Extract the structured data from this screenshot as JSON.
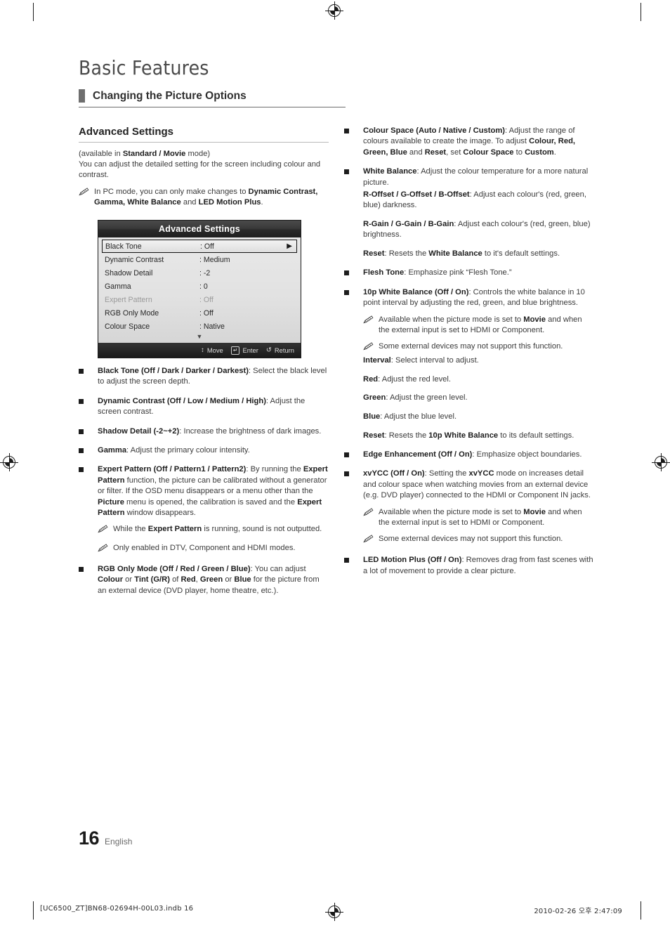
{
  "document": {
    "title": "Basic Features",
    "section_title": "Changing the Picture Options",
    "page_number": "16",
    "language": "English"
  },
  "left_column": {
    "sub_heading": "Advanced Settings",
    "intro_line1_pre": "(available in ",
    "intro_line1_bold": "Standard / Movie",
    "intro_line1_post": " mode)",
    "intro_line2": "You can adjust the detailed setting for the screen including colour and contrast.",
    "note_pc_pre": "In PC mode, you can only make changes to ",
    "note_pc_bold1": "Dynamic Contrast, Gamma, White Balance",
    "note_pc_mid": " and ",
    "note_pc_bold2": "LED Motion Plus",
    "note_pc_post": ".",
    "bullets": {
      "black_tone_bold": "Black Tone (Off / Dark / Darker / Darkest)",
      "black_tone_text": ": Select the black level to adjust the screen depth.",
      "dynamic_contrast_bold": "Dynamic Contrast (Off / Low / Medium / High)",
      "dynamic_contrast_text": ": Adjust the screen contrast.",
      "shadow_detail_bold": "Shadow Detail (-2~+2)",
      "shadow_detail_text": ": Increase the brightness of dark images.",
      "gamma_bold": "Gamma",
      "gamma_text": ": Adjust the primary colour intensity.",
      "expert_pattern_bold": "Expert Pattern (Off / Pattern1 / Pattern2)",
      "expert_pattern_t1": ": By running the ",
      "expert_pattern_b2": "Expert Pattern",
      "expert_pattern_t2": " function, the picture can be calibrated without a generator or filter. If the OSD menu disappears or a menu other than the ",
      "expert_pattern_b3": "Picture",
      "expert_pattern_t3": " menu is opened, the calibration is saved and the ",
      "expert_pattern_b4": "Expert Pattern",
      "expert_pattern_t4": " window disappears.",
      "note_sound_pre": "While the ",
      "note_sound_bold": "Expert Pattern",
      "note_sound_post": " is running, sound is not outputted.",
      "note_dtv": "Only enabled in DTV, Component and HDMI modes.",
      "rgb_only_bold": "RGB Only Mode (Off / Red / Green / Blue)",
      "rgb_only_t1": ": You can adjust ",
      "rgb_only_b2": "Colour",
      "rgb_only_t2": " or ",
      "rgb_only_b3": "Tint (G/R)",
      "rgb_only_t3": " of ",
      "rgb_only_b4": "Red",
      "rgb_only_t4": ", ",
      "rgb_only_b5": "Green",
      "rgb_only_t5": " or ",
      "rgb_only_b6": "Blue",
      "rgb_only_t6": " for the picture from an external device (DVD player, home theatre, etc.)."
    }
  },
  "osd": {
    "title": "Advanced Settings",
    "rows": [
      {
        "label": "Black Tone",
        "value": ": Off",
        "selected": true,
        "dim": false,
        "arrow": "▶"
      },
      {
        "label": "Dynamic Contrast",
        "value": ": Medium",
        "selected": false,
        "dim": false,
        "arrow": ""
      },
      {
        "label": "Shadow Detail",
        "value": ": -2",
        "selected": false,
        "dim": false,
        "arrow": ""
      },
      {
        "label": "Gamma",
        "value": ": 0",
        "selected": false,
        "dim": false,
        "arrow": ""
      },
      {
        "label": "Expert Pattern",
        "value": ": Off",
        "selected": false,
        "dim": true,
        "arrow": ""
      },
      {
        "label": "RGB Only Mode",
        "value": ": Off",
        "selected": false,
        "dim": false,
        "arrow": ""
      },
      {
        "label": "Colour Space",
        "value": ": Native",
        "selected": false,
        "dim": false,
        "arrow": ""
      }
    ],
    "scroll_down_glyph": "▼",
    "footer": {
      "move_glyph": "↕",
      "move_label": "Move",
      "enter_key": "↵",
      "enter_label": "Enter",
      "return_glyph": "↺",
      "return_label": "Return"
    }
  },
  "right_column": {
    "colour_space_bold": "Colour Space (Auto / Native / Custom)",
    "colour_space_t1": ": Adjust the range of colours available to create the image. To adjust ",
    "colour_space_b2": "Colour, Red, Green, Blue",
    "colour_space_t2": " and ",
    "colour_space_b3": "Reset",
    "colour_space_t3": ", set ",
    "colour_space_b4": "Colour Space",
    "colour_space_t4": " to ",
    "colour_space_b5": "Custom",
    "colour_space_t5": ".",
    "white_balance_bold": "White Balance",
    "white_balance_text": ": Adjust the colour temperature for a more natural picture.",
    "offset_bold": "R-Offset / G-Offset / B-Offset",
    "offset_text": ": Adjust each colour's (red, green, blue) darkness.",
    "gain_bold": "R-Gain / G-Gain / B-Gain",
    "gain_text": ": Adjust each colour's (red, green, blue) brightness.",
    "wb_reset_bold": "Reset",
    "wb_reset_t1": ": Resets the ",
    "wb_reset_b2": "White Balance",
    "wb_reset_t2": " to it's default settings.",
    "flesh_tone_bold": "Flesh Tone",
    "flesh_tone_text": ": Emphasize pink “Flesh Tone.”",
    "tenp_bold": "10p White Balance (Off / On)",
    "tenp_text": ": Controls the white balance in 10 point interval by adjusting the red, green, and blue brightness.",
    "note_movie_pre": "Available when the picture mode is set to ",
    "note_movie_bold": "Movie",
    "note_movie_post": " and when the external input is set to HDMI or Component.",
    "note_devices": "Some external devices may not support this function.",
    "interval_bold": "Interval",
    "interval_text": ": Select interval to adjust.",
    "red_bold": "Red",
    "red_text": ": Adjust the red level.",
    "green_bold": "Green",
    "green_text": ": Adjust the green level.",
    "blue_bold": "Blue",
    "blue_text": ": Adjust the blue level.",
    "tenp_reset_bold": "Reset",
    "tenp_reset_t1": ": Resets the ",
    "tenp_reset_b2": "10p White Balance",
    "tenp_reset_t2": " to its default settings.",
    "edge_bold": "Edge Enhancement (Off / On)",
    "edge_text": ": Emphasize object boundaries.",
    "xvycc_bold": "xvYCC (Off / On)",
    "xvycc_t1": ": Setting the ",
    "xvycc_b2": "xvYCC",
    "xvycc_t2": " mode on increases detail and colour space when watching movies from an external device (e.g. DVD player) connected to the HDMI or Component IN jacks.",
    "led_bold": "LED Motion Plus (Off / On)",
    "led_text": ": Removes drag from fast scenes with a lot of movement to provide a clear picture."
  },
  "print_slug": {
    "left": "[UC6500_ZT]BN68-02694H-00L03.indb   16",
    "right": "2010-02-26   오후 2:47:09"
  }
}
